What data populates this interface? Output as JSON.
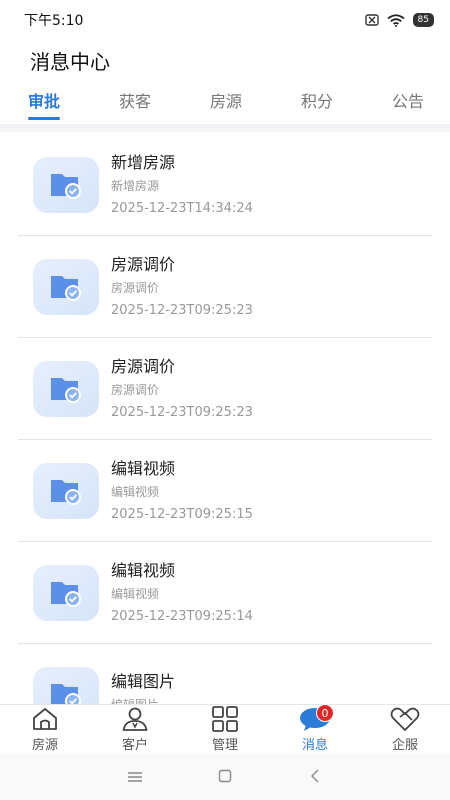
{
  "status_bar": {
    "time": "下午5:10",
    "battery": "85"
  },
  "page": {
    "title": "消息中心"
  },
  "tabs": [
    {
      "label": "审批",
      "active": true
    },
    {
      "label": "获客",
      "active": false
    },
    {
      "label": "房源",
      "active": false
    },
    {
      "label": "积分",
      "active": false
    },
    {
      "label": "公告",
      "active": false
    }
  ],
  "messages": [
    {
      "title": "新增房源",
      "subtitle": "新增房源",
      "time": "2025-12-23T14:34:24"
    },
    {
      "title": "房源调价",
      "subtitle": "房源调价",
      "time": "2025-12-23T09:25:23"
    },
    {
      "title": "房源调价",
      "subtitle": "房源调价",
      "time": "2025-12-23T09:25:23"
    },
    {
      "title": "编辑视频",
      "subtitle": "编辑视频",
      "time": "2025-12-23T09:25:15"
    },
    {
      "title": "编辑视频",
      "subtitle": "编辑视频",
      "time": "2025-12-23T09:25:14"
    },
    {
      "title": "编辑图片",
      "subtitle": "编辑图片",
      "time": ""
    }
  ],
  "bottom_nav": [
    {
      "label": "房源",
      "icon": "house-icon"
    },
    {
      "label": "客户",
      "icon": "person-icon"
    },
    {
      "label": "管理",
      "icon": "grid-icon"
    },
    {
      "label": "消息",
      "icon": "chat-icon",
      "badge": "0",
      "active": true
    },
    {
      "label": "企服",
      "icon": "handshake-icon"
    }
  ],
  "colors": {
    "accent": "#2b7bd9",
    "badge": "#e02828"
  }
}
